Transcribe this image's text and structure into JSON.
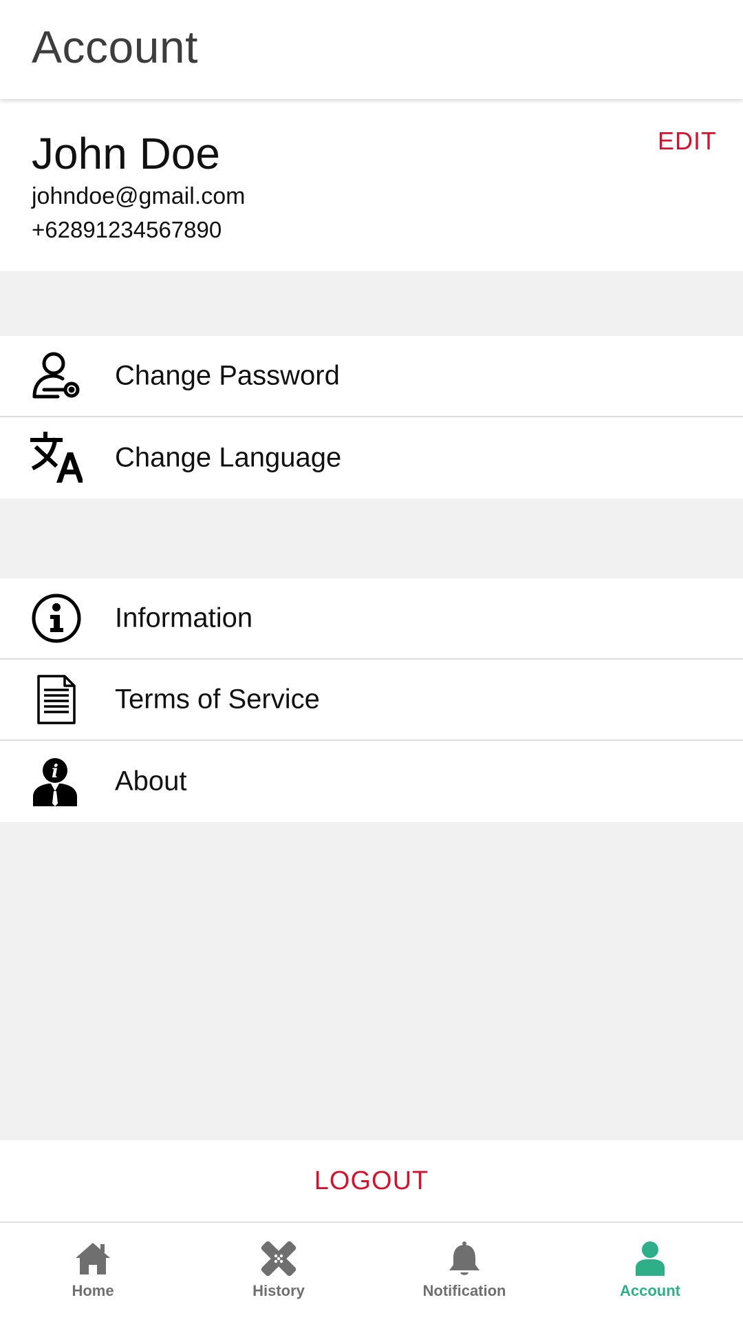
{
  "header": {
    "title": "Account"
  },
  "profile": {
    "name": "John Doe",
    "email": "johndoe@gmail.com",
    "phone": "+62891234567890",
    "edit_label": "EDIT"
  },
  "menu_groups": [
    {
      "items": [
        {
          "label": "Change Password",
          "icon": "user-key-icon"
        },
        {
          "label": "Change Language",
          "icon": "translate-icon"
        }
      ]
    },
    {
      "items": [
        {
          "label": "Information",
          "icon": "info-circle-icon"
        },
        {
          "label": "Terms of Service",
          "icon": "document-icon"
        },
        {
          "label": "About",
          "icon": "person-info-icon"
        }
      ]
    }
  ],
  "logout": {
    "label": "LOGOUT"
  },
  "bottom_nav": {
    "items": [
      {
        "label": "Home",
        "icon": "home-icon"
      },
      {
        "label": "History",
        "icon": "bandage-icon"
      },
      {
        "label": "Notification",
        "icon": "bell-icon"
      },
      {
        "label": "Account",
        "icon": "person-icon"
      }
    ],
    "active": "Account"
  },
  "colors": {
    "accent_red": "#d4122e",
    "active_green": "#2fae8a",
    "inactive_gray": "#6f6f6f",
    "background": "#f1f1f1"
  }
}
